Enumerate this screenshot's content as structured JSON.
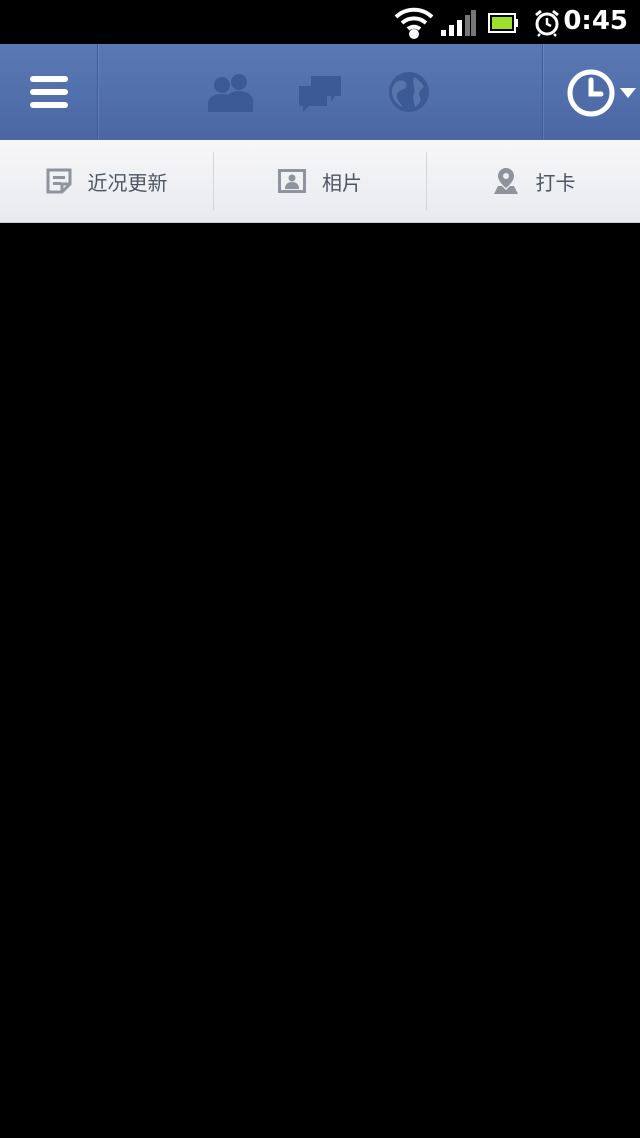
{
  "status_bar": {
    "time": "0:45",
    "icons": [
      "wifi-icon",
      "signal-icon",
      "battery-icon",
      "alarm-icon"
    ],
    "battery_color": "#9be02a"
  },
  "app_bar": {
    "background": "#4f6ca8",
    "icons": [
      "menu-icon",
      "friends-icon",
      "messages-icon",
      "notifications-globe-icon",
      "clock-icon",
      "dropdown-arrow-icon"
    ]
  },
  "subnav": {
    "items": [
      {
        "label": "近况更新",
        "icon": "status-update-icon"
      },
      {
        "label": "相片",
        "icon": "photo-icon"
      },
      {
        "label": "打卡",
        "icon": "check-in-icon"
      }
    ]
  }
}
